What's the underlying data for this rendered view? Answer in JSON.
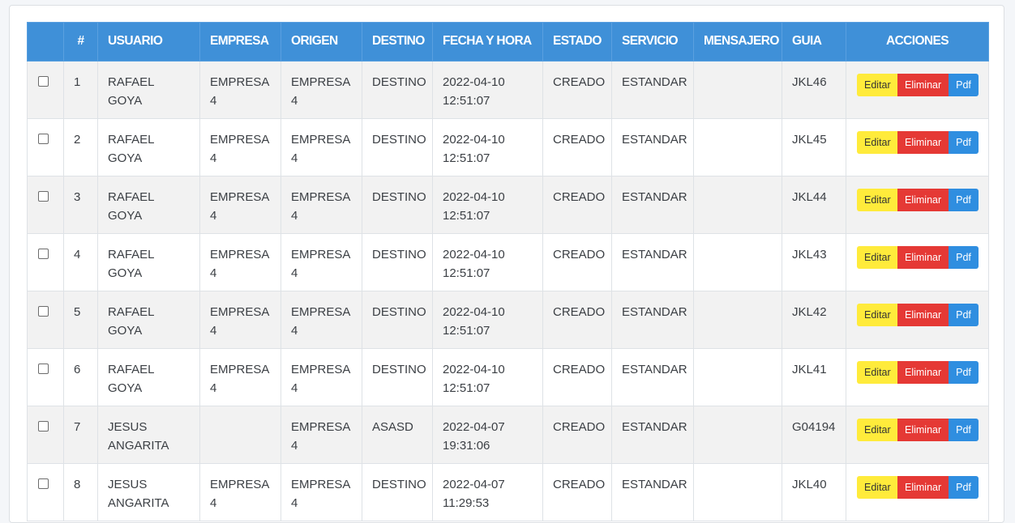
{
  "table": {
    "headers": [
      "",
      "#",
      "USUARIO",
      "EMPRESA",
      "ORIGEN",
      "DESTINO",
      "FECHA Y HORA",
      "ESTADO",
      "SERVICIO",
      "MENSAJERO",
      "GUIA",
      "ACCIONES"
    ],
    "actions": {
      "edit": "Editar",
      "delete": "Eliminar",
      "pdf": "Pdf"
    },
    "rows": [
      {
        "num": "1",
        "usuario": "RAFAEL GOYA",
        "empresa": "EMPRESA 4",
        "origen": "EMPRESA 4",
        "destino": "DESTINO",
        "fecha": "2022-04-10 12:51:07",
        "estado": "CREADO",
        "servicio": "ESTANDAR",
        "mensajero": "",
        "guia": "JKL46"
      },
      {
        "num": "2",
        "usuario": "RAFAEL GOYA",
        "empresa": "EMPRESA 4",
        "origen": "EMPRESA 4",
        "destino": "DESTINO",
        "fecha": "2022-04-10 12:51:07",
        "estado": "CREADO",
        "servicio": "ESTANDAR",
        "mensajero": "",
        "guia": "JKL45"
      },
      {
        "num": "3",
        "usuario": "RAFAEL GOYA",
        "empresa": "EMPRESA 4",
        "origen": "EMPRESA 4",
        "destino": "DESTINO",
        "fecha": "2022-04-10 12:51:07",
        "estado": "CREADO",
        "servicio": "ESTANDAR",
        "mensajero": "",
        "guia": "JKL44"
      },
      {
        "num": "4",
        "usuario": "RAFAEL GOYA",
        "empresa": "EMPRESA 4",
        "origen": "EMPRESA 4",
        "destino": "DESTINO",
        "fecha": "2022-04-10 12:51:07",
        "estado": "CREADO",
        "servicio": "ESTANDAR",
        "mensajero": "",
        "guia": "JKL43"
      },
      {
        "num": "5",
        "usuario": "RAFAEL GOYA",
        "empresa": "EMPRESA 4",
        "origen": "EMPRESA 4",
        "destino": "DESTINO",
        "fecha": "2022-04-10 12:51:07",
        "estado": "CREADO",
        "servicio": "ESTANDAR",
        "mensajero": "",
        "guia": "JKL42"
      },
      {
        "num": "6",
        "usuario": "RAFAEL GOYA",
        "empresa": "EMPRESA 4",
        "origen": "EMPRESA 4",
        "destino": "DESTINO",
        "fecha": "2022-04-10 12:51:07",
        "estado": "CREADO",
        "servicio": "ESTANDAR",
        "mensajero": "",
        "guia": "JKL41"
      },
      {
        "num": "7",
        "usuario": "JESUS ANGARITA",
        "empresa": "",
        "origen": "EMPRESA 4",
        "destino": "ASASD",
        "fecha": "2022-04-07 19:31:06",
        "estado": "CREADO",
        "servicio": "ESTANDAR",
        "mensajero": "",
        "guia": "G04194"
      },
      {
        "num": "8",
        "usuario": "JESUS ANGARITA",
        "empresa": "EMPRESA 4",
        "origen": "EMPRESA 4",
        "destino": "DESTINO",
        "fecha": "2022-04-07 11:29:53",
        "estado": "CREADO",
        "servicio": "ESTANDAR",
        "mensajero": "",
        "guia": "JKL40"
      }
    ]
  }
}
